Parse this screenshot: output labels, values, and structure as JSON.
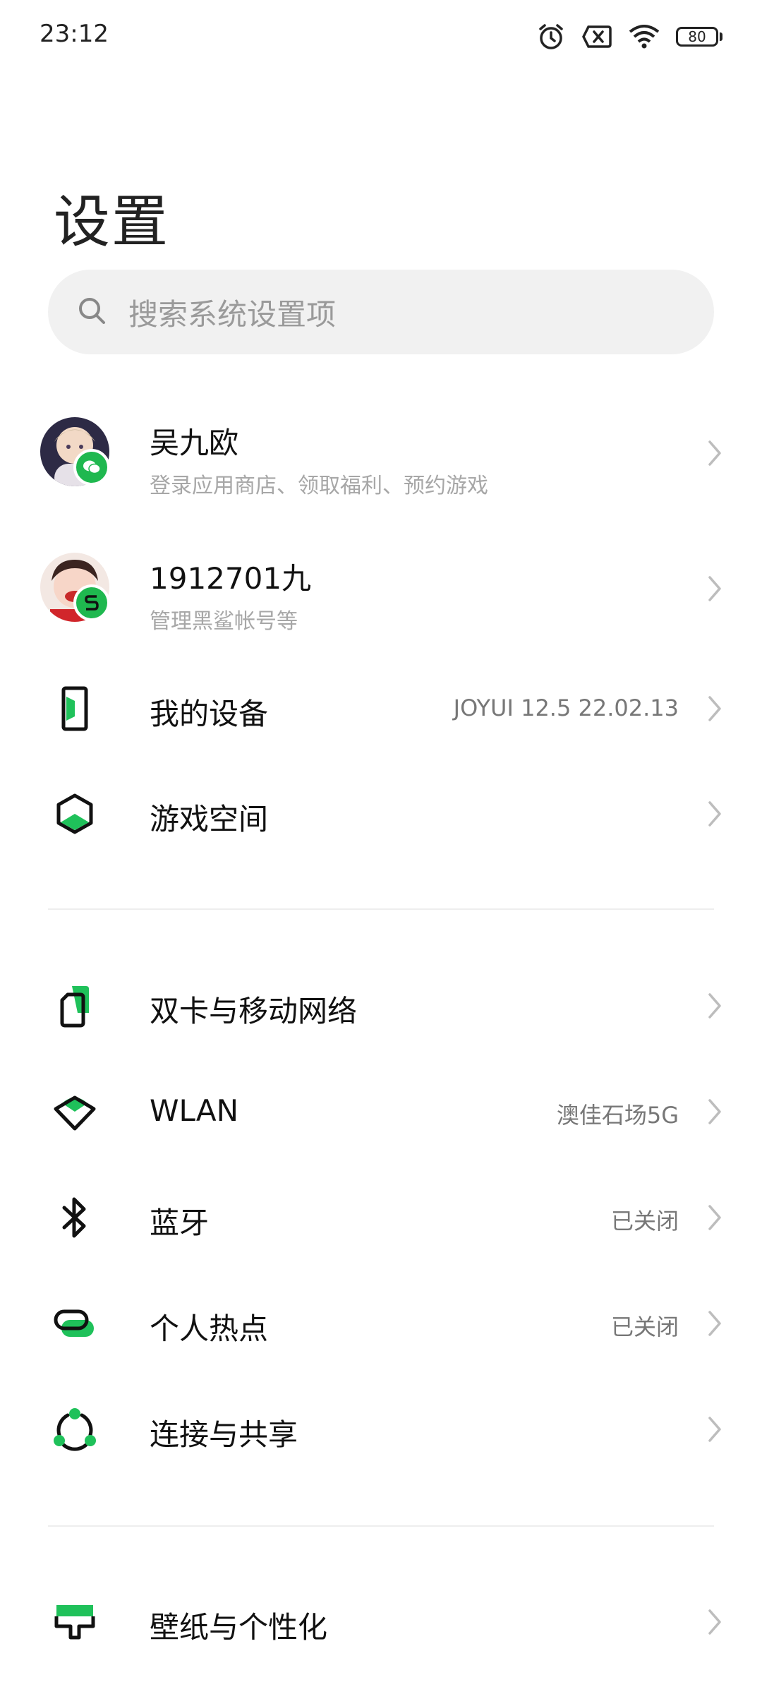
{
  "status_bar": {
    "time": "23:12",
    "battery": "80",
    "icons": [
      "alarm-icon",
      "no-sim-icon",
      "wifi-icon",
      "battery-icon"
    ]
  },
  "page": {
    "title": "设置"
  },
  "search": {
    "placeholder": "搜索系统设置项"
  },
  "accounts": [
    {
      "name": "吴九欧",
      "subtitle": "登录应用商店、领取福利、预约游戏",
      "badge": "wechat-icon"
    },
    {
      "name": "1912701九",
      "subtitle": "管理黑鲨帐号等",
      "badge": "blackshark-icon"
    }
  ],
  "items": [
    {
      "label": "我的设备",
      "value": "JOYUI 12.5 22.02.13",
      "icon": "device-icon"
    },
    {
      "label": "游戏空间",
      "value": "",
      "icon": "game-space-icon"
    },
    {
      "label": "双卡与移动网络",
      "value": "",
      "icon": "sim-card-icon"
    },
    {
      "label": "WLAN",
      "value": "澳佳石场5G",
      "icon": "wlan-icon"
    },
    {
      "label": "蓝牙",
      "value": "已关闭",
      "icon": "bluetooth-icon"
    },
    {
      "label": "个人热点",
      "value": "已关闭",
      "icon": "hotspot-icon"
    },
    {
      "label": "连接与共享",
      "value": "",
      "icon": "connection-share-icon"
    },
    {
      "label": "壁纸与个性化",
      "value": "",
      "icon": "wallpaper-icon"
    }
  ],
  "colors": {
    "accent": "#1fc15a",
    "icon_dark": "#111111",
    "search_bg": "#f1f1f1"
  }
}
